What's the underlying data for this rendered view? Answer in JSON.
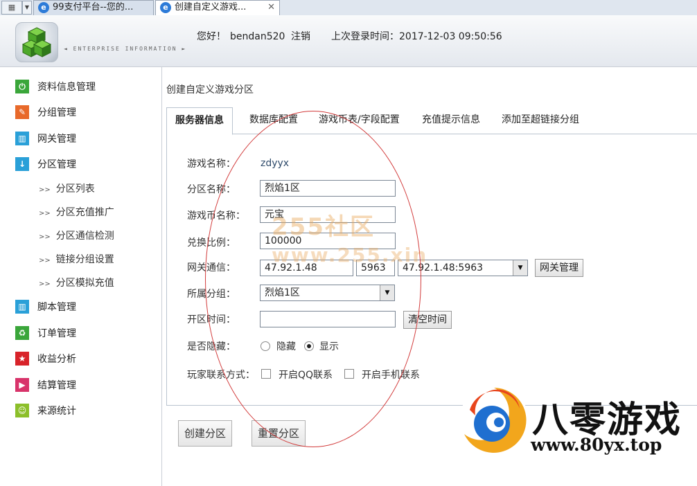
{
  "browser": {
    "tabs": [
      {
        "title": "99支付平台--您的..."
      },
      {
        "title": "创建自定义游戏..."
      }
    ]
  },
  "header": {
    "greeting": "您好！",
    "username": "bendan520",
    "logout": "注销",
    "last_login": "上次登录时间：2017-12-03 09:50:56",
    "logo_caption": "◄ ENTERPRISE INFORMATION ►"
  },
  "sidebar": {
    "items": [
      {
        "label": "资料信息管理",
        "icon": "power-icon",
        "color": "#3aa63a"
      },
      {
        "label": "分组管理",
        "icon": "pencil-icon",
        "color": "#e8692a"
      },
      {
        "label": "网关管理",
        "icon": "grid-icon",
        "color": "#2aa0d8"
      },
      {
        "label": "分区管理",
        "icon": "arrow-down-icon",
        "color": "#2aa0d8"
      },
      {
        "label": "脚本管理",
        "icon": "grid-icon",
        "color": "#2aa0d8"
      },
      {
        "label": "订单管理",
        "icon": "recycle-icon",
        "color": "#3aa63a"
      },
      {
        "label": "收益分析",
        "icon": "star-icon",
        "color": "#d8232a"
      },
      {
        "label": "结算管理",
        "icon": "play-icon",
        "color": "#d8336a"
      },
      {
        "label": "来源统计",
        "icon": "smile-icon",
        "color": "#8cbf2a"
      }
    ],
    "subitems": [
      {
        "label": "分区列表"
      },
      {
        "label": "分区充值推广"
      },
      {
        "label": "分区通信检测"
      },
      {
        "label": "链接分组设置"
      },
      {
        "label": "分区模拟充值"
      }
    ]
  },
  "main": {
    "breadcrumb": "创建自定义游戏分区",
    "tabs": [
      {
        "label": "服务器信息"
      },
      {
        "label": "数据库配置"
      },
      {
        "label": "游戏币表/字段配置"
      },
      {
        "label": "充值提示信息"
      },
      {
        "label": "添加至超链接分组"
      }
    ],
    "form": {
      "game_name_label": "游戏名称：",
      "game_name_value": "zdyyx",
      "zone_name_label": "分区名称：",
      "zone_name_value": "烈焰1区",
      "currency_label": "游戏币名称：",
      "currency_value": "元宝",
      "ratio_label": "兑换比例：",
      "ratio_value": "100000",
      "gateway_label": "网关通信：",
      "gateway_ip": "47.92.1.48",
      "gateway_port": "5963",
      "gateway_select": "47.92.1.48:5963",
      "gateway_btn": "网关管理",
      "group_label": "所属分组：",
      "group_value": "烈焰1区",
      "open_time_label": "开区时间：",
      "open_time_value": "",
      "clear_time_btn": "清空时间",
      "hidden_label": "是否隐藏：",
      "hidden_opt_hide": "隐藏",
      "hidden_opt_show": "显示",
      "contact_label": "玩家联系方式：",
      "contact_qq": "开启QQ联系",
      "contact_phone": "开启手机联系"
    },
    "buttons": {
      "create": "创建分区",
      "reset": "重置分区"
    }
  },
  "watermark": {
    "line1": "255社区",
    "line2": "www.255.xin"
  },
  "brand": {
    "name": "八零游戏",
    "url": "www.80yx.top"
  }
}
